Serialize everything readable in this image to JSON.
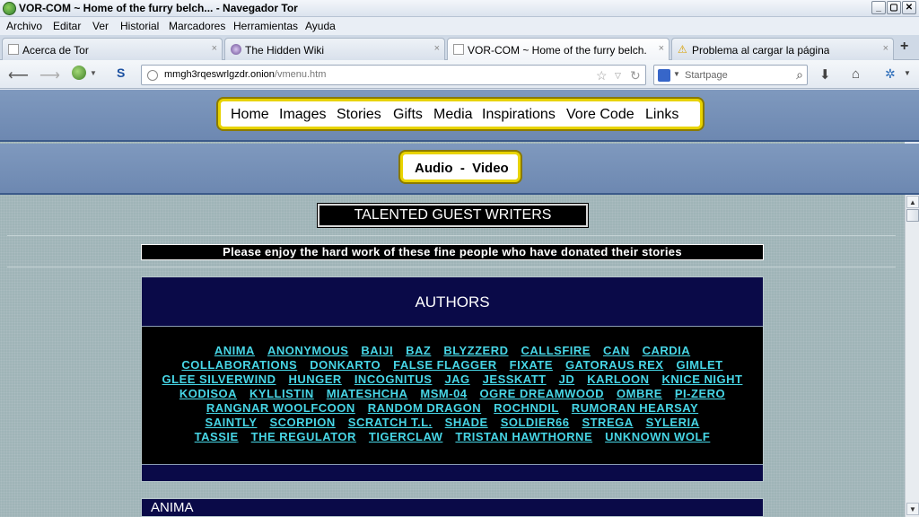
{
  "window": {
    "title": "VOR-COM ~ Home of the furry belch... - Navegador Tor",
    "controls": {
      "minimize": "_",
      "maximize": "▢",
      "close": "✕"
    }
  },
  "menubar": [
    "Archivo",
    "Editar",
    "Ver",
    "Historial",
    "Marcadores",
    "Herramientas",
    "Ayuda"
  ],
  "tabs": [
    {
      "label": "Acerca de Tor",
      "icon": "page-icon"
    },
    {
      "label": "The Hidden Wiki",
      "icon": "tor-onion-icon"
    },
    {
      "label": "VOR-COM ~ Home of the furry belch...",
      "icon": "page-icon",
      "active": true
    },
    {
      "label": "Problema al cargar la página",
      "icon": "warning-icon"
    }
  ],
  "newtab_label": "+",
  "tab_close": "×",
  "nav": {
    "url_host": "mmgh3rqeswrlgzdr.onion",
    "url_path": "/vmenu.htm",
    "search_placeholder": "Startpage"
  },
  "site": {
    "main_menu": [
      "Home",
      "Images",
      "Stories",
      "Gifts",
      "Media",
      "Inspirations",
      "Vore Code",
      "Links"
    ],
    "sub_menu": "Audio  -  Video",
    "guest_title": "TALENTED GUEST WRITERS",
    "enjoy_text": "Please enjoy the hard work of these fine people who have donated their stories",
    "authors_heading": "AUTHORS",
    "author_rows": [
      [
        "ANIMA",
        "ANONYMOUS",
        "BAIJI",
        "BAZ",
        "BLYZZERD",
        "CALLSFIRE",
        "CAN",
        "CARDIA"
      ],
      [
        "COLLABORATIONS",
        "DONKARTO",
        "FALSE FLAGGER",
        "FIXATE",
        "GATORAUS REX",
        "GIMLET"
      ],
      [
        "GLEE SILVERWIND",
        "HUNGER",
        "INCOGNITUS",
        "JAG",
        "JESSKATT",
        "JD",
        "KARLOON",
        "KNICE NIGHT"
      ],
      [
        "KODISOA",
        "KYLLISTIN",
        "MIATESHCHA",
        "MSM-04",
        "OGRE DREAMWOOD",
        "OMBRE",
        "PI-ZERO"
      ],
      [
        "RANGNAR WOOLFCOON",
        "RANDOM DRAGON",
        "ROCHNDIL",
        "RUMORAN HEARSAY"
      ],
      [
        "SAINTLY",
        "SCORPION",
        "SCRATCH T.L.",
        "SHADE",
        "SOLDIER66",
        "STREGA",
        "SYLERIA"
      ],
      [
        "TASSIE",
        "THE REGULATOR",
        "TIGERCLAW",
        "TRISTAN HAWTHORNE",
        "UNKNOWN WOLF"
      ]
    ],
    "section_heading": "ANIMA"
  },
  "colors": {
    "link": "#47d6e6",
    "panel_navy": "#0a0a48",
    "menu_border": "#e8d300",
    "band": "#7f99be"
  }
}
